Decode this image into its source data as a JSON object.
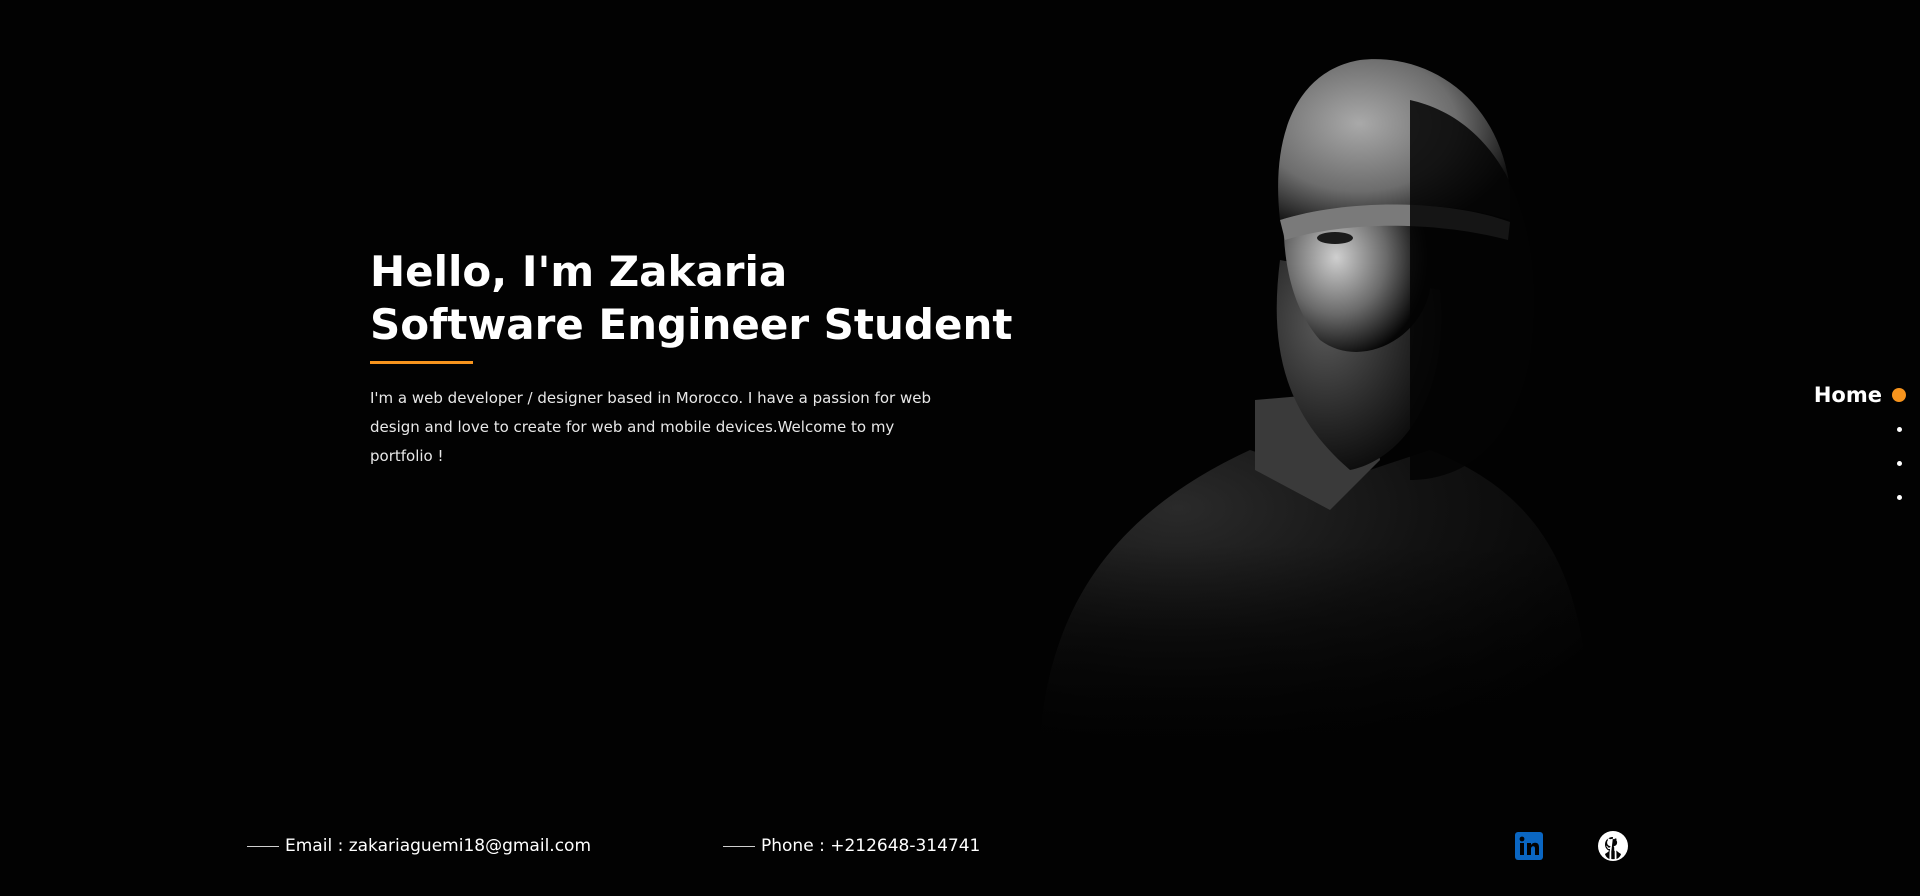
{
  "hero": {
    "title_line1": "Hello, I'm Zakaria",
    "title_line2": "Software Engineer Student",
    "description": "I'm a web developer / designer based in Morocco. I have a passion for web design and love to create for web and mobile devices.Welcome to my portfolio !"
  },
  "nav": {
    "items": [
      {
        "label": "Home",
        "active": true
      },
      {
        "label": "",
        "active": false
      },
      {
        "label": "",
        "active": false
      },
      {
        "label": "",
        "active": false
      }
    ]
  },
  "footer": {
    "email": "Email : zakariaguemi18@gmail.com",
    "phone": "Phone : +212648-314741",
    "social": [
      {
        "icon": "linkedin-icon",
        "color": "#0a66c2"
      },
      {
        "icon": "github-icon",
        "color": "#ffffff"
      }
    ]
  },
  "colors": {
    "accent": "#f7941d",
    "background": "#020202",
    "text": "#ffffff"
  }
}
